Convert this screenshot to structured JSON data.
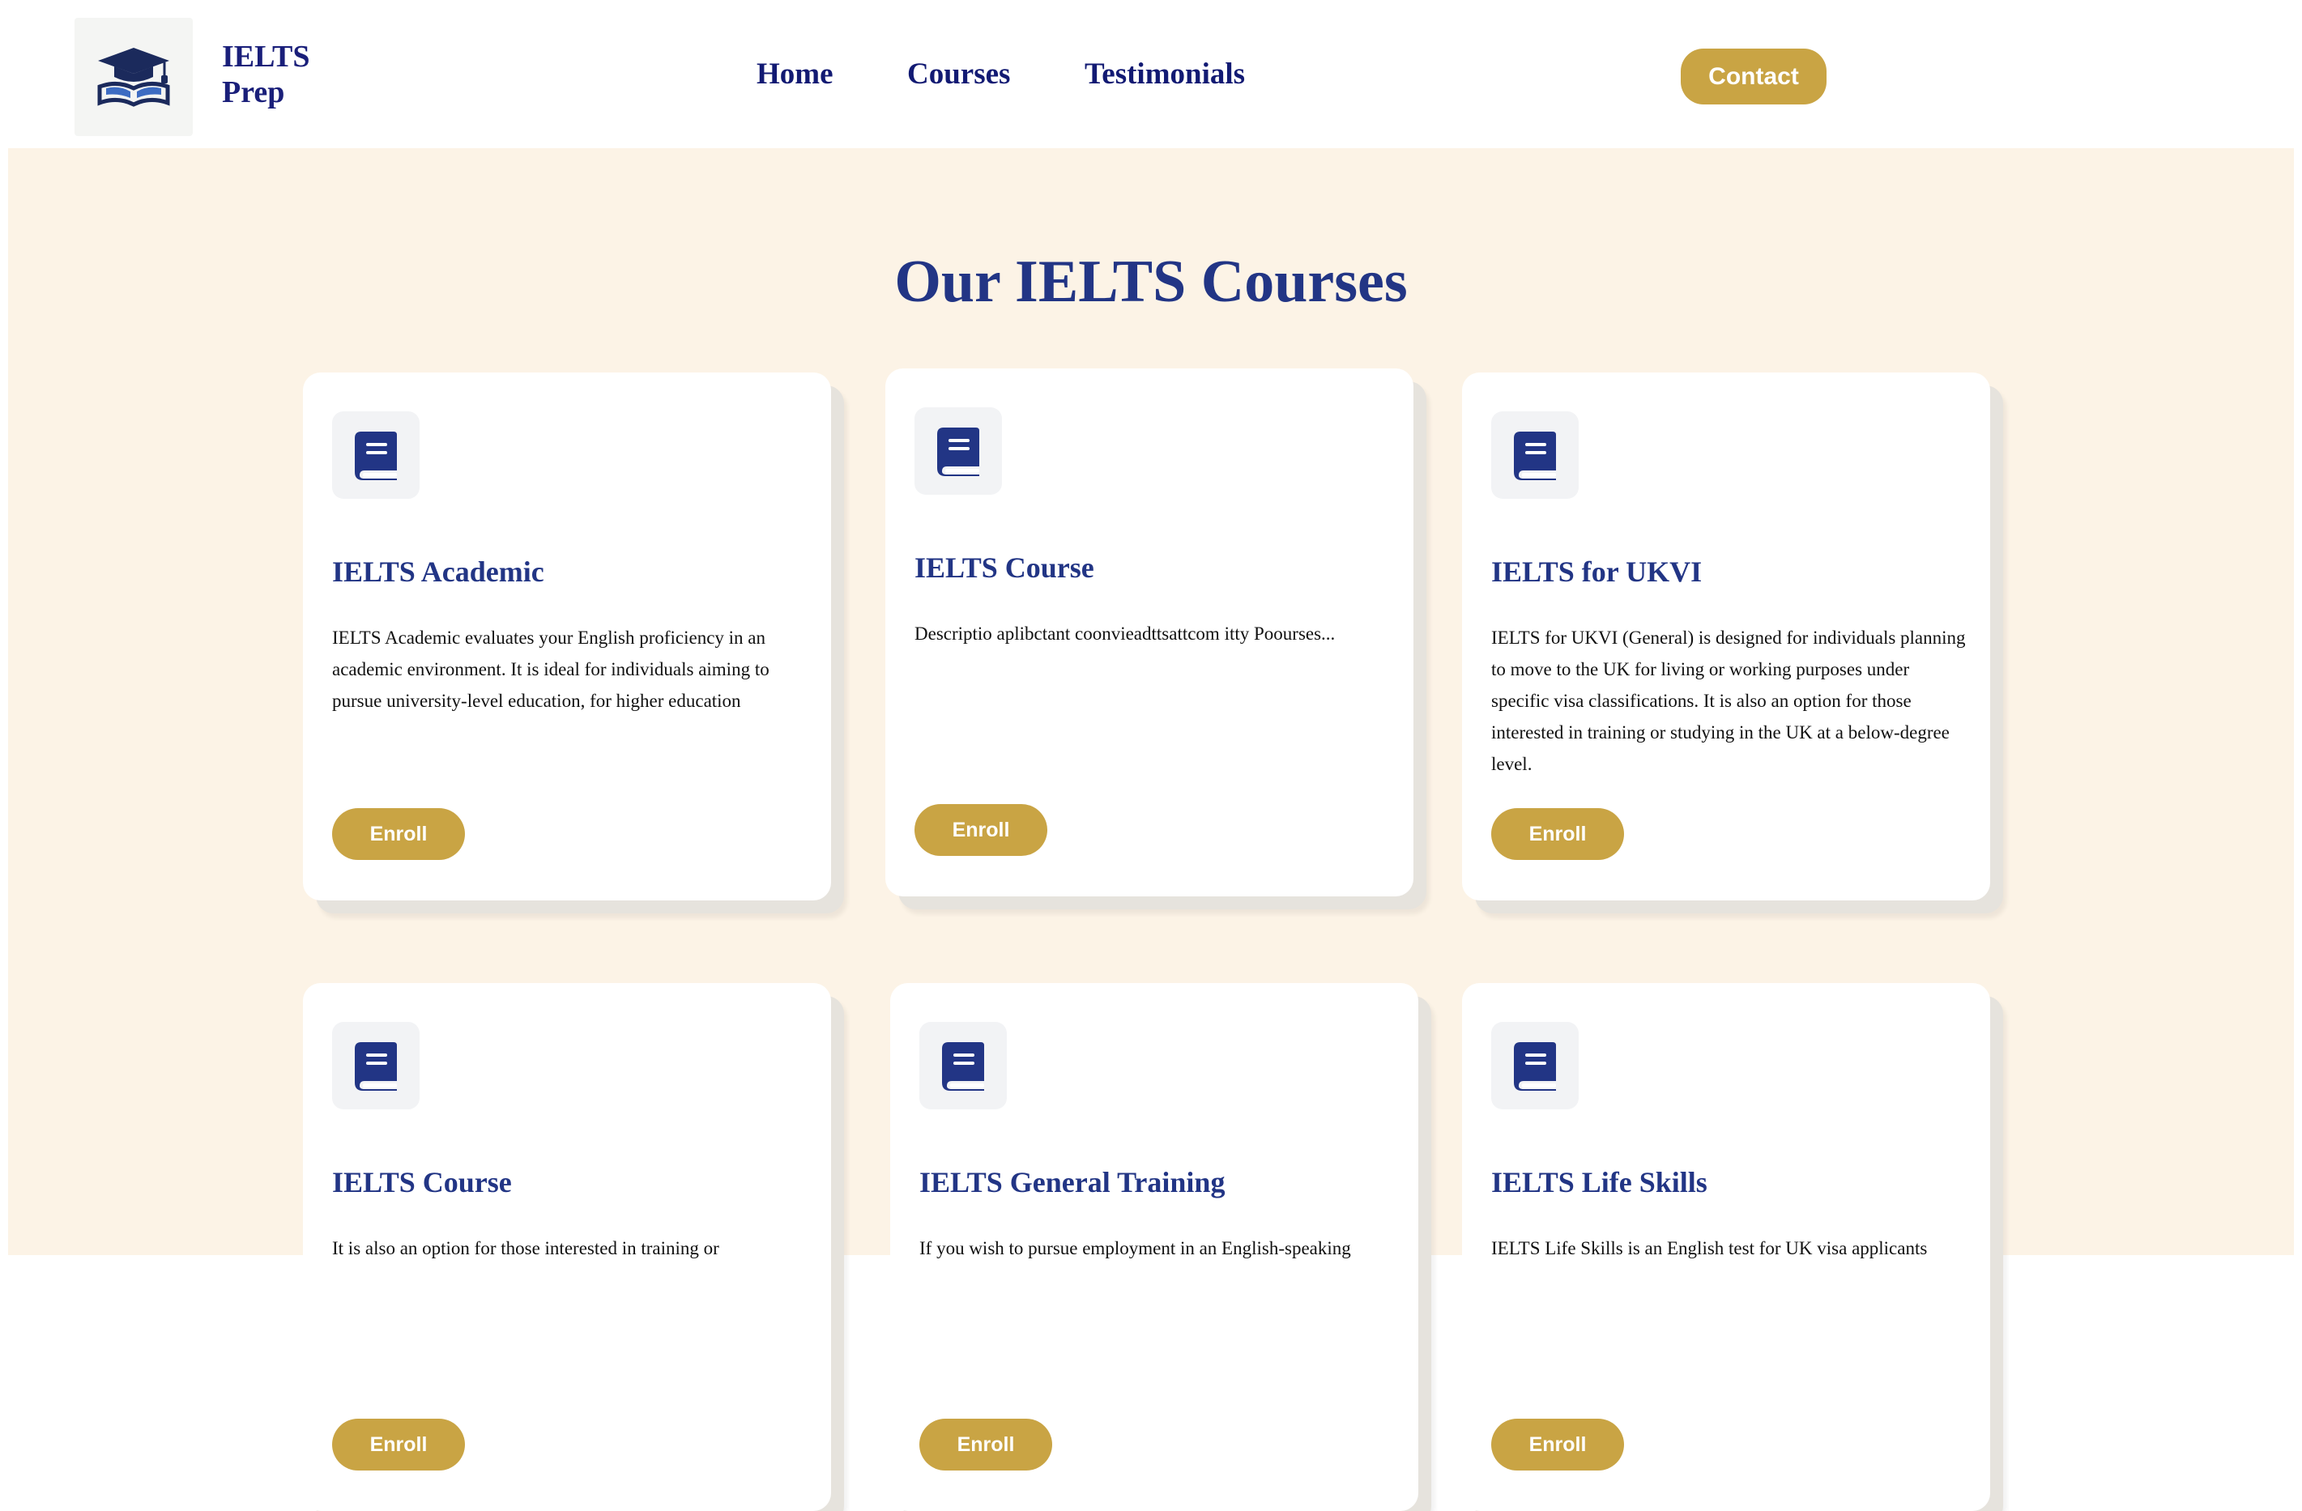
{
  "brand": {
    "line1": "IELTS",
    "line2": "Prep",
    "logo_icon": "graduation-cap-book-icon"
  },
  "nav": {
    "home": "Home",
    "courses": "Courses",
    "testimonials": "Testimonials"
  },
  "header": {
    "contact_label": "Contact"
  },
  "colors": {
    "primary_navy": "#223585",
    "accent_gold": "#c9a444",
    "section_background": "#fcf3e6"
  },
  "courses_section": {
    "title": "Our IELTS Courses",
    "cards": [
      {
        "icon": "book-icon",
        "title": "IELTS Academic",
        "description": "IELTS Academic evaluates your English proficiency in an academic environment. It is ideal for individuals aiming to pursue university-level education, for higher education",
        "button": "Enroll"
      },
      {
        "icon": "book-icon",
        "title": "IELTS Course",
        "description": "Descriptio aplibctant coonvieadttsattcom itty Poourses...",
        "button": "Enroll"
      },
      {
        "icon": "book-icon",
        "title": "IELTS for UKVI",
        "description": "IELTS for UKVI (General) is designed for individuals planning to move to the UK for living or working purposes under specific visa classifications. It is also an option for those interested in training or studying in the UK at a below-degree level.",
        "button": "Enroll"
      },
      {
        "icon": "book-icon",
        "title": "IELTS Course",
        "description": "It is also an option for those interested in training or",
        "button": "Enroll"
      },
      {
        "icon": "book-icon",
        "title": "IELTS General Training",
        "description": "If you wish to pursue employment in an English-speaking",
        "button": "Enroll"
      },
      {
        "icon": "book-icon",
        "title": "IELTS Life Skills",
        "description": "IELTS Life Skills is an English test for UK visa applicants",
        "button": "Enroll"
      }
    ]
  }
}
